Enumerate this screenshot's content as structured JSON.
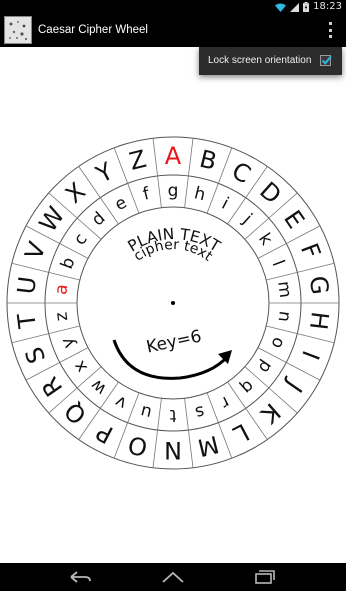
{
  "status_bar": {
    "time": "18:23",
    "icons": [
      "wifi-icon",
      "signal-icon",
      "battery-icon"
    ]
  },
  "action_bar": {
    "title": "Caesar Cipher Wheel",
    "menu_icon": "overflow-menu-icon"
  },
  "menu": {
    "items": [
      {
        "label": "Lock screen orientation",
        "checked": true
      }
    ]
  },
  "wheel": {
    "outer_letters": [
      "A",
      "B",
      "C",
      "D",
      "E",
      "F",
      "G",
      "H",
      "I",
      "J",
      "K",
      "L",
      "M",
      "N",
      "O",
      "P",
      "Q",
      "R",
      "S",
      "T",
      "U",
      "V",
      "W",
      "X",
      "Y",
      "Z"
    ],
    "inner_letters": [
      "g",
      "h",
      "i",
      "j",
      "k",
      "l",
      "m",
      "n",
      "o",
      "p",
      "q",
      "r",
      "s",
      "t",
      "u",
      "v",
      "w",
      "x",
      "y",
      "z",
      "a",
      "b",
      "c",
      "d",
      "e",
      "f"
    ],
    "highlight_outer": "A",
    "highlight_inner": "a",
    "highlight_color": "#e8171b",
    "plain_label": "PLAIN TEXT",
    "cipher_label": "cipher text",
    "key_label": "Key=6",
    "key": 6
  },
  "nav_bar": {
    "icons": [
      "back-icon",
      "home-icon",
      "recent-apps-icon"
    ]
  },
  "colors": {
    "bar_background": "#000000",
    "wheel_stroke": "#555555",
    "menu_background": "#2c2c2c",
    "check_color": "#33b5e5"
  }
}
